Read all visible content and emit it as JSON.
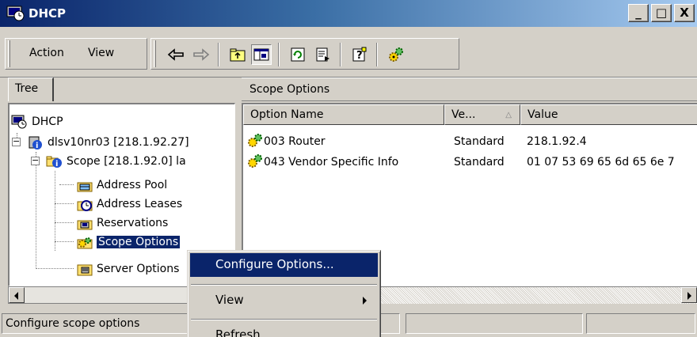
{
  "window": {
    "title": "DHCP",
    "buttons": {
      "minimize": "_",
      "maximize": "□",
      "close": "X"
    }
  },
  "menubar": {
    "items": [
      {
        "label": "Action"
      },
      {
        "label": "View"
      }
    ]
  },
  "toolbar": {
    "icons": [
      "back-arrow-icon",
      "forward-arrow-icon",
      "up-folder-icon",
      "show-hide-tree-icon",
      "refresh-icon",
      "export-list-icon",
      "help-icon",
      "options-gear-icon"
    ]
  },
  "tree": {
    "tab_label": "Tree",
    "nodes": [
      {
        "label": "DHCP",
        "icon": "dhcp-console-icon"
      },
      {
        "label": "dlsv10nr03 [218.1.92.27]",
        "icon": "server-icon"
      },
      {
        "label": "Scope [218.1.92.0] la",
        "icon": "scope-folder-icon"
      },
      {
        "label": "Address Pool",
        "icon": "address-pool-icon"
      },
      {
        "label": "Address Leases",
        "icon": "address-leases-icon"
      },
      {
        "label": "Reservations",
        "icon": "reservations-icon"
      },
      {
        "label": "Scope Options",
        "icon": "scope-options-icon",
        "selected": true
      },
      {
        "label": "Server Options",
        "icon": "server-options-icon"
      }
    ]
  },
  "details": {
    "header": "Scope Options",
    "columns": [
      "Option Name",
      "Ve...",
      "Value"
    ],
    "rows": [
      {
        "name": "003 Router",
        "vendor": "Standard",
        "value": "218.1.92.4"
      },
      {
        "name": "043 Vendor Specific Info",
        "vendor": "Standard",
        "value": "01 07 53 69 65 6d 65 6e 7"
      }
    ]
  },
  "context_menu": {
    "items": [
      {
        "label": "Configure Options...",
        "highlighted": true
      },
      {
        "label": "View",
        "submenu": true
      },
      {
        "label": "Refresh"
      }
    ]
  },
  "statusbar": {
    "text": "Configure scope options"
  }
}
